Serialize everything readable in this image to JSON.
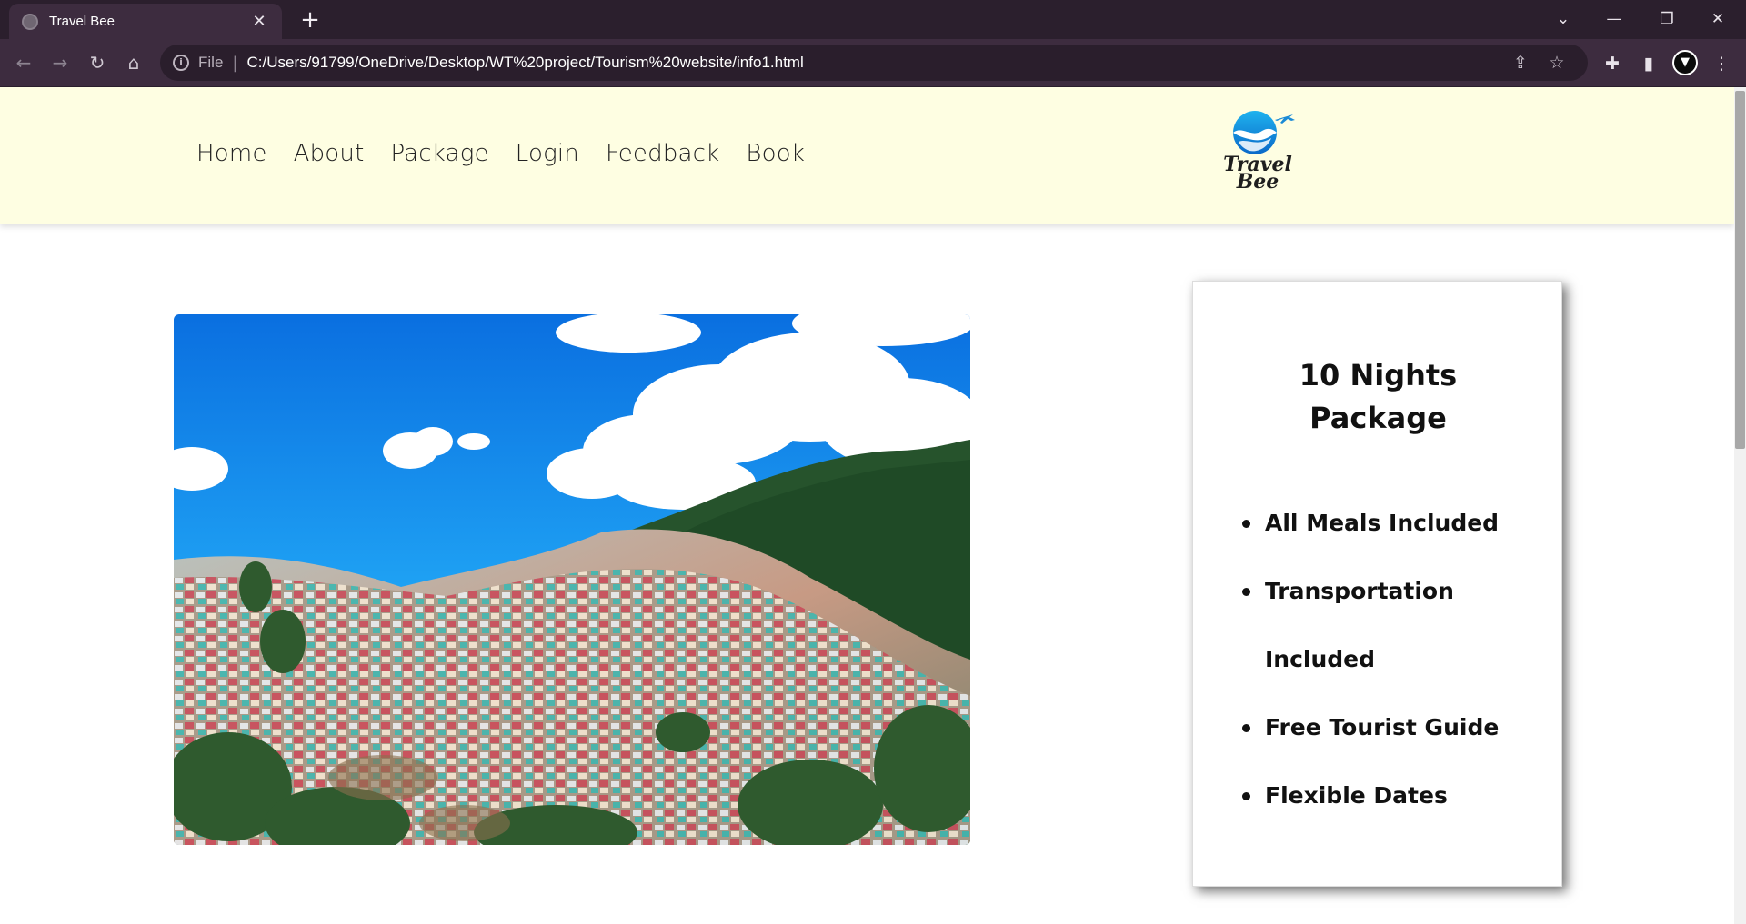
{
  "browser": {
    "tab_title": "Travel Bee",
    "scheme_label": "File",
    "url": "C:/Users/91799/OneDrive/Desktop/WT%20project/Tourism%20website/info1.html"
  },
  "site": {
    "nav": [
      "Home",
      "About",
      "Package",
      "Login",
      "Feedback",
      "Book"
    ],
    "logo_line1": "Travel",
    "logo_line2": "Bee"
  },
  "package": {
    "title_line1": "10 Nights",
    "title_line2": "Package",
    "features": [
      "All Meals Included",
      "Transportation Included",
      "Free Tourist Guide",
      "Flexible Dates"
    ]
  },
  "colors": {
    "header_bg": "#fefee2",
    "browser_frame": "#2b1f2d",
    "sky": "#1a8ff0"
  }
}
